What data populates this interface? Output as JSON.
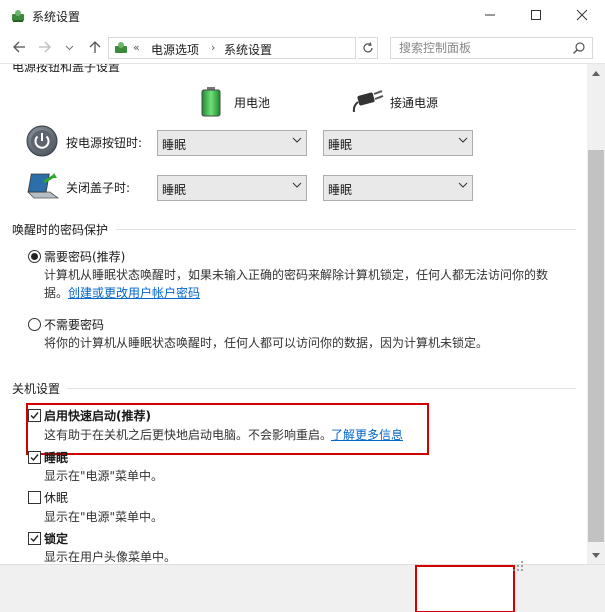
{
  "window": {
    "title": "系统设置"
  },
  "nav": {
    "breadcrumbs": [
      "电源选项",
      "系统设置"
    ],
    "search_placeholder": "搜索控制面板"
  },
  "content": {
    "cut_heading": "电源按钮和盖子设置",
    "columns": [
      "用电池",
      "接通电源"
    ],
    "rows": [
      {
        "label": "按电源按钮时:",
        "battery": "睡眠",
        "plugged": "睡眠"
      },
      {
        "label": "关闭盖子时:",
        "battery": "睡眠",
        "plugged": "睡眠"
      }
    ],
    "password": {
      "title": "唤醒时的密码保护",
      "require_label": "需要密码(推荐)",
      "require_desc_1": "计算机从睡眠状态唤醒时，如果未输入正确的密码来解除计算机锁定，任何人都无法访问你的数",
      "require_desc_2": "据。",
      "require_link": "创建或更改用户帐户密码",
      "no_label": "不需要密码",
      "no_desc": "将你的计算机从睡眠状态唤醒时，任何人都可以访问你的数据，因为计算机未锁定。"
    },
    "shutdown": {
      "title": "关机设置",
      "fast_label": "启用快速启动(推荐)",
      "fast_desc": "这有助于在关机之后更快地启动电脑。不会影响重启。",
      "fast_link": "了解更多信息",
      "sleep_label": "睡眠",
      "sleep_desc": "显示在\"电源\"菜单中。",
      "hibernate_label": "休眠",
      "hibernate_desc": "显示在\"电源\"菜单中。",
      "lock_label": "锁定",
      "lock_desc": "显示在用户头像菜单中。"
    }
  },
  "colors": {
    "highlight": "#d40000",
    "link": "#0066cc"
  }
}
